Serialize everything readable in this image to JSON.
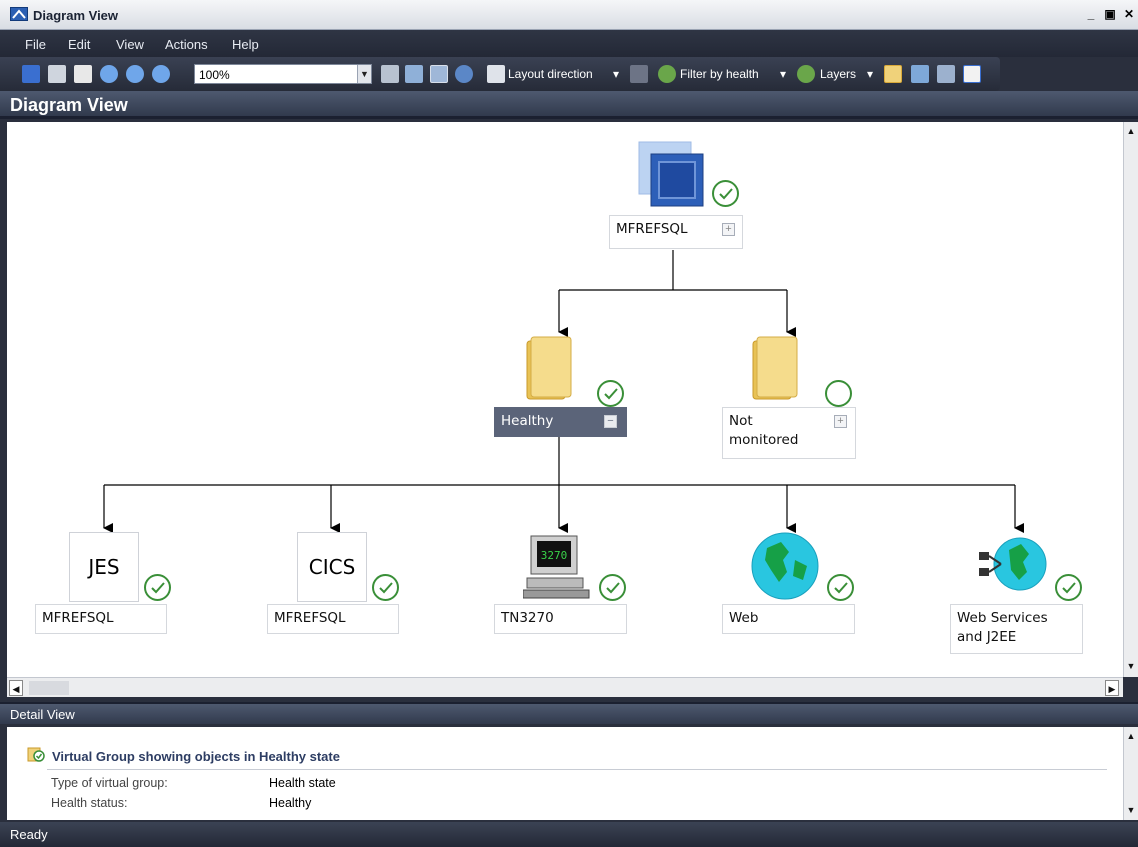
{
  "window": {
    "title": "Diagram View"
  },
  "menu": [
    "File",
    "Edit",
    "View",
    "Actions",
    "Help"
  ],
  "toolbar": {
    "zoom_value": "100%",
    "layout_direction_label": "Layout direction",
    "filter_by_health_label": "Filter by health",
    "layers_label": "Layers"
  },
  "diagram": {
    "header": "Diagram View",
    "root": {
      "label": "MFREFSQL",
      "health": "healthy"
    },
    "groups": [
      {
        "label": "Healthy",
        "health": "healthy",
        "selected": true,
        "expanded": true
      },
      {
        "label": "Not monitored",
        "health": "not-monitored",
        "selected": false,
        "expanded": false
      }
    ],
    "leaves": [
      {
        "icon_text": "JES",
        "label": "MFREFSQL",
        "health": "healthy"
      },
      {
        "icon_text": "CICS",
        "label": "MFREFSQL",
        "health": "healthy"
      },
      {
        "icon_text": "3270",
        "label": "TN3270",
        "health": "healthy"
      },
      {
        "icon_text": "",
        "label": "Web",
        "health": "healthy"
      },
      {
        "icon_text": "",
        "label": "Web Services and J2EE",
        "health": "healthy"
      }
    ]
  },
  "detail": {
    "header": "Detail View",
    "title": "Virtual Group showing objects in Healthy state",
    "rows": [
      {
        "key": "Type of virtual group:",
        "value": "Health state"
      },
      {
        "key": "Health status:",
        "value": "Healthy"
      }
    ]
  },
  "status": {
    "text": "Ready"
  },
  "colors": {
    "healthy": "#3a8f38",
    "selected_node": "#5b6479",
    "header_bg": "#3d4659"
  }
}
